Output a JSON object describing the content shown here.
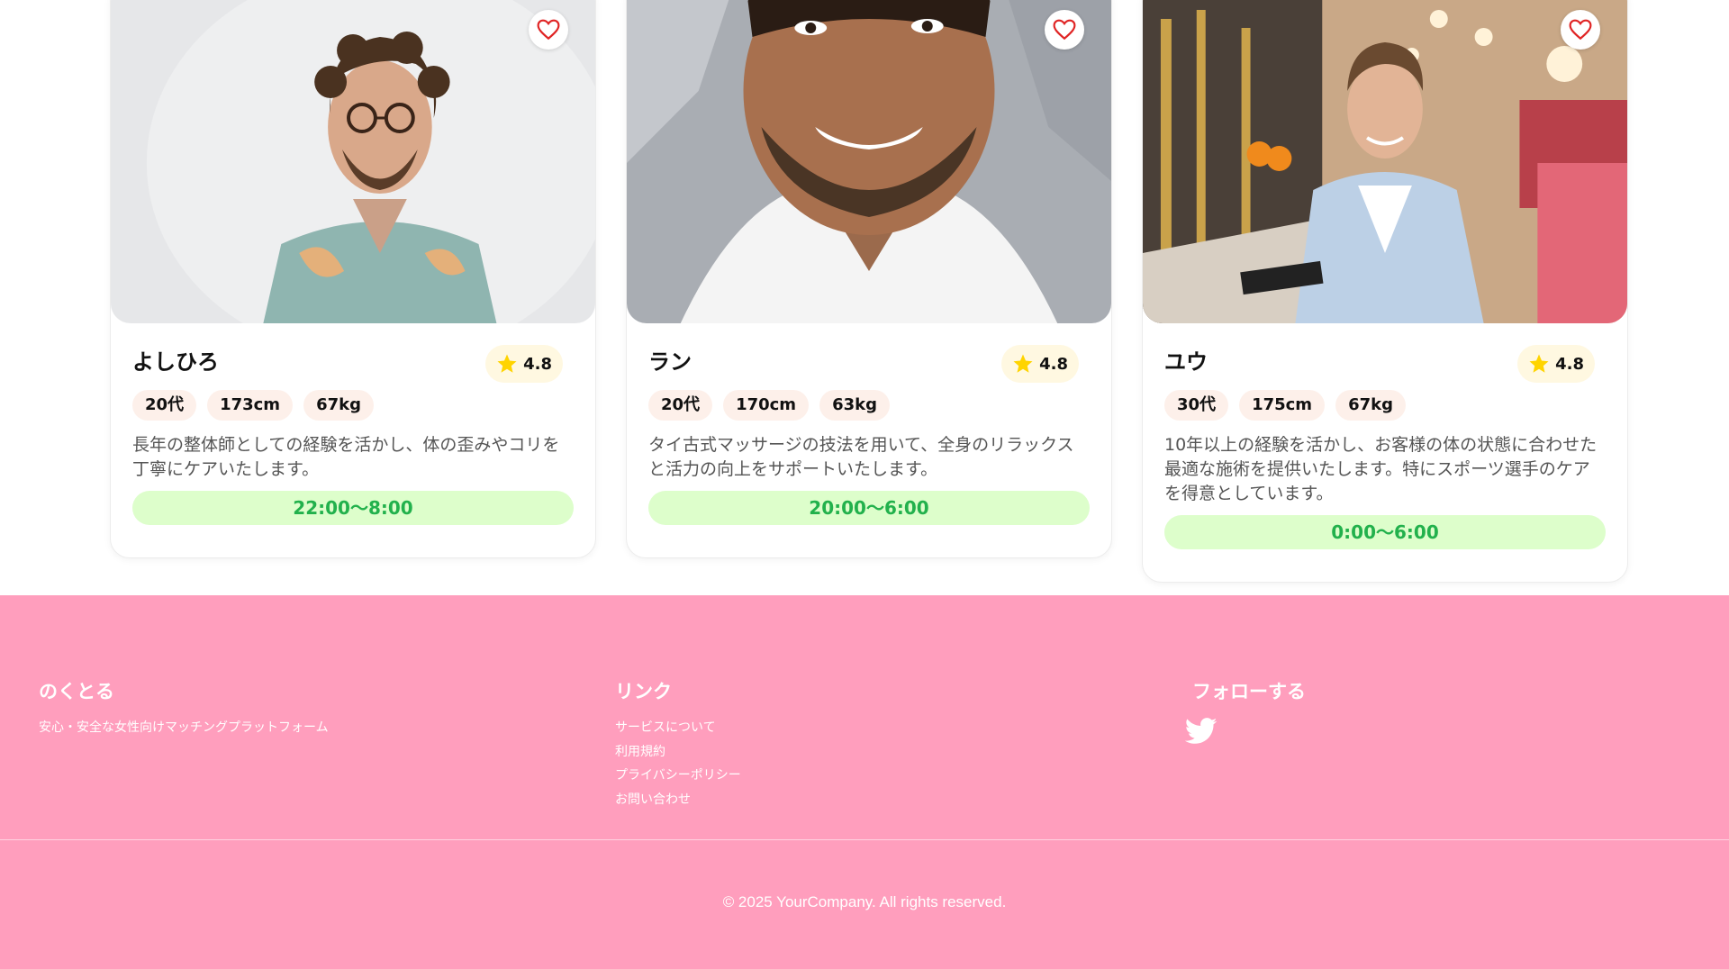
{
  "cards": [
    {
      "name": "よしひろ",
      "rating": "4.8",
      "tags": [
        "20代",
        "173cm",
        "67kg"
      ],
      "description": "長年の整体師としての経験を活かし、体の歪みやコリを丁寧にケアいたします。",
      "hours": "22:00〜8:00",
      "photo_icon": "portrait-photo"
    },
    {
      "name": "ラン",
      "rating": "4.8",
      "tags": [
        "20代",
        "170cm",
        "63kg"
      ],
      "description": "タイ古式マッサージの技法を用いて、全身のリラックスと活力の向上をサポートいたします。",
      "hours": "20:00〜6:00",
      "photo_icon": "portrait-photo"
    },
    {
      "name": "ユウ",
      "rating": "4.8",
      "tags": [
        "30代",
        "175cm",
        "67kg"
      ],
      "description": "10年以上の経験を活かし、お客様の体の状態に合わせた最適な施術を提供いたします。特にスポーツ選手のケアを得意としています。",
      "hours": "0:00〜6:00",
      "photo_icon": "portrait-photo"
    }
  ],
  "footer": {
    "brand": {
      "title": "のくとる",
      "tagline": "安心・安全な女性向けマッチングプラットフォーム"
    },
    "links": {
      "title": "リンク",
      "items": [
        "サービスについて",
        "利用規約",
        "プライバシーポリシー",
        "お問い合わせ"
      ]
    },
    "follow": {
      "title": "フォローする",
      "icon": "twitter-icon"
    },
    "copyright": "© 2025 YourCompany. All rights reserved."
  },
  "colors": {
    "footer_bg": "#ff9ebd",
    "hours_bg": "#ddfecb",
    "hours_text": "#22b14c",
    "tag_bg": "#fdf0ea",
    "rating_bg": "#fff8e1",
    "star": "#ffd400",
    "heart": "#e02424"
  }
}
